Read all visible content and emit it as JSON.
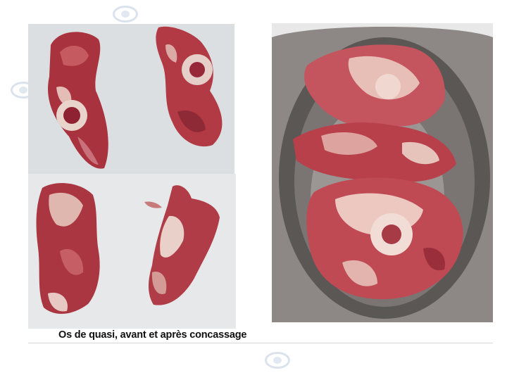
{
  "figure": {
    "caption": "Os de quasi, avant et après concassage"
  },
  "photos": [
    {
      "subject": "raw-bone-pieces-before"
    },
    {
      "subject": "raw-bone-pieces-before"
    },
    {
      "subject": "crushed-bones-in-bowl"
    }
  ],
  "colors": {
    "meat": "#b5404a",
    "fat": "#e8c7c0",
    "bowl": "#6f6a68",
    "caption": "#111111"
  }
}
